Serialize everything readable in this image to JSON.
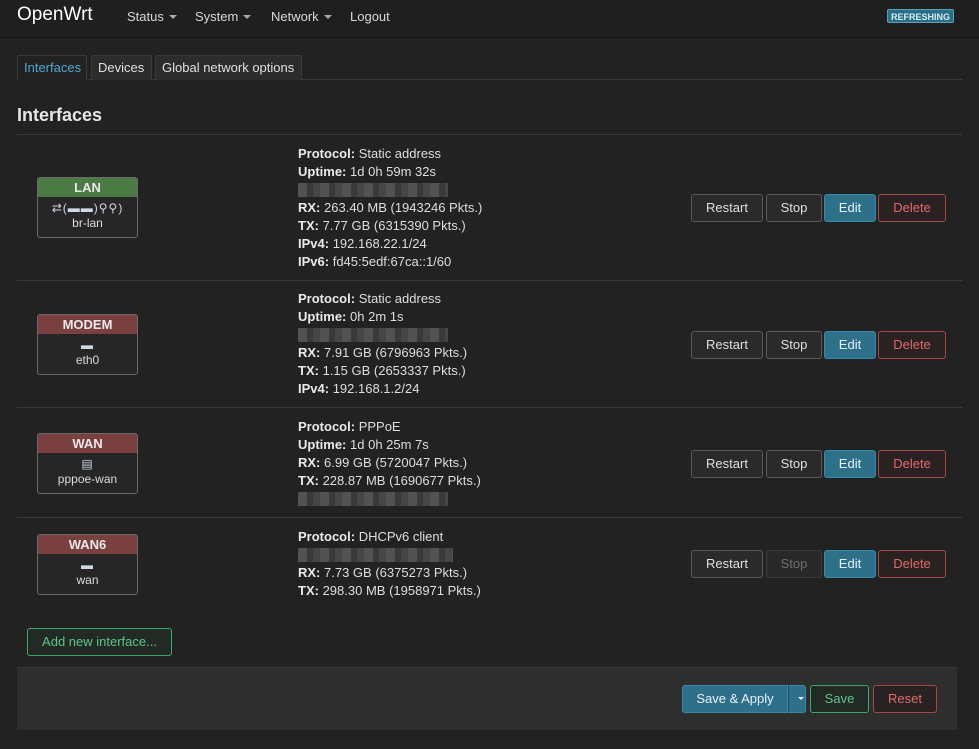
{
  "header": {
    "brand": "OpenWrt",
    "menu": [
      "Status",
      "System",
      "Network",
      "Logout"
    ],
    "badge": "REFRESHING"
  },
  "tabs": [
    "Interfaces",
    "Devices",
    "Global network options"
  ],
  "section_title": "Interfaces",
  "labels": {
    "protocol": "Protocol:",
    "uptime": "Uptime:",
    "rx": "RX:",
    "tx": "TX:",
    "ipv4": "IPv4:",
    "ipv6": "IPv6:"
  },
  "interfaces": [
    {
      "name": "LAN",
      "device": "br-lan",
      "icons": "⇄(▬▬)⚲⚲)",
      "protocol": "Static address",
      "uptime": "1d 0h 59m 32s",
      "rx": "263.40 MB (1943246 Pkts.)",
      "tx": "7.77 GB (6315390 Pkts.)",
      "ipv4": "192.168.22.1/24",
      "ipv6": "fd45:5edf:67ca::1/60"
    },
    {
      "name": "MODEM",
      "device": "eth0",
      "icons": "▬",
      "protocol": "Static address",
      "uptime": "0h 2m 1s",
      "rx": "7.91 GB (6796963 Pkts.)",
      "tx": "1.15 GB (2653337 Pkts.)",
      "ipv4": "192.168.1.2/24"
    },
    {
      "name": "WAN",
      "device": "pppoe-wan",
      "icons": "▤",
      "protocol": "PPPoE",
      "uptime": "1d 0h 25m 7s",
      "rx": "6.99 GB (5720047 Pkts.)",
      "tx": "228.87 MB (1690677 Pkts.)"
    },
    {
      "name": "WAN6",
      "device": "wan",
      "icons": "▬",
      "protocol": "DHCPv6 client",
      "rx": "7.73 GB (6375273 Pkts.)",
      "tx": "298.30 MB (1958971 Pkts.)"
    }
  ],
  "buttons": {
    "restart": "Restart",
    "stop": "Stop",
    "edit": "Edit",
    "delete": "Delete",
    "add": "Add new interface...",
    "save_apply": "Save & Apply",
    "save": "Save",
    "reset": "Reset"
  },
  "colors": {
    "accent": "#2e6f8a",
    "lan_badge": "#4b7a45",
    "wan_badge": "#7a4040",
    "danger": "#e06a6a",
    "success": "#5cc48c"
  }
}
